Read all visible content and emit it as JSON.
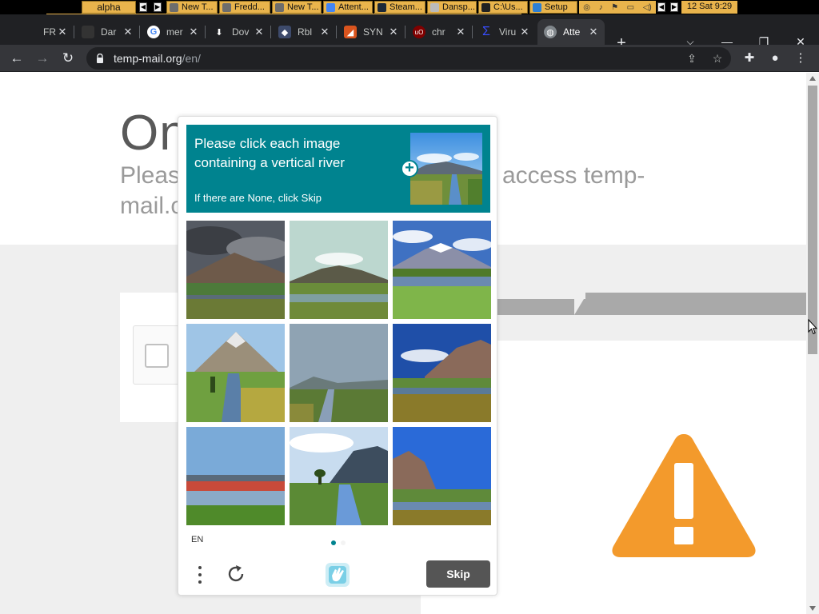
{
  "taskbar": {
    "workspace": "alpha",
    "windows": [
      "New T...",
      "Fredd...",
      "New T...",
      "Attent...",
      "Steam...",
      "Dansp...",
      "C:\\Us...",
      "Setup"
    ],
    "clock": "12 Sat 9:29"
  },
  "browser": {
    "tabs": [
      {
        "label": "FRE",
        "icon": "generic-icon"
      },
      {
        "label": "Dar",
        "icon": "dark-icon"
      },
      {
        "label": "mer",
        "icon": "google-icon"
      },
      {
        "label": "Dov",
        "icon": "download-icon"
      },
      {
        "label": "Rbl",
        "icon": "roblox-icon"
      },
      {
        "label": "SYN",
        "icon": "synapse-icon"
      },
      {
        "label": "chr",
        "icon": "ublock-icon"
      },
      {
        "label": "Viru",
        "icon": "virustotal-icon"
      },
      {
        "label": "Atte",
        "icon": "globe-icon",
        "active": true
      }
    ],
    "url_host": "temp-mail.org",
    "url_path": "/en/"
  },
  "page": {
    "headline": "On",
    "sub_line1_left": "Please",
    "sub_line1_right": "access temp-",
    "sub_line2": "mail.o"
  },
  "captcha": {
    "prompt": "Please click each image containing a vertical river",
    "hint": "If there are None, click Skip",
    "language": "EN",
    "skip_label": "Skip",
    "accent_color": "#00838f"
  },
  "colors": {
    "warning": "#f39a2c",
    "taskbar_accent": "#e9b44c"
  }
}
